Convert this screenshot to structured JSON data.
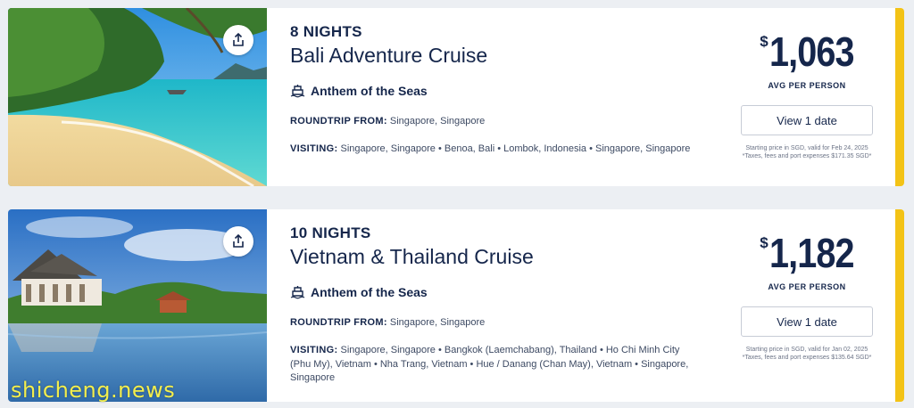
{
  "colors": {
    "accent": "#f3c316",
    "navy": "#15264b"
  },
  "cruises": [
    {
      "nights": "8 NIGHTS",
      "title": "Bali Adventure Cruise",
      "ship": "Anthem of the Seas",
      "ship_icon": "ship-icon",
      "roundtrip_label": "ROUNDTRIP FROM:",
      "roundtrip_value": "Singapore, Singapore",
      "visiting_label": "VISITING:",
      "visiting_value": "Singapore, Singapore • Benoa, Bali • Lombok, Indonesia • Singapore, Singapore",
      "currency": "$",
      "price": "1,063",
      "price_label": "AVG PER PERSON",
      "button": "View 1 date",
      "note1": "Starting price in SGD, valid for Feb 24, 2025",
      "note2": "*Taxes, fees and port expenses $171.35 SGD*"
    },
    {
      "nights": "10 NIGHTS",
      "title": "Vietnam & Thailand Cruise",
      "ship": "Anthem of the Seas",
      "ship_icon": "ship-icon",
      "roundtrip_label": "ROUNDTRIP FROM:",
      "roundtrip_value": "Singapore, Singapore",
      "visiting_label": "VISITING:",
      "visiting_value": "Singapore, Singapore • Bangkok (Laemchabang), Thailand • Ho Chi Minh City (Phu My), Vietnam • Nha Trang, Vietnam • Hue / Danang (Chan May), Vietnam • Singapore, Singapore",
      "currency": "$",
      "price": "1,182",
      "price_label": "AVG PER PERSON",
      "button": "View 1 date",
      "note1": "Starting price in SGD, valid for Jan 02, 2025",
      "note2": "*Taxes, fees and port expenses $135.64 SGD*"
    }
  ],
  "watermark": "shicheng.news"
}
